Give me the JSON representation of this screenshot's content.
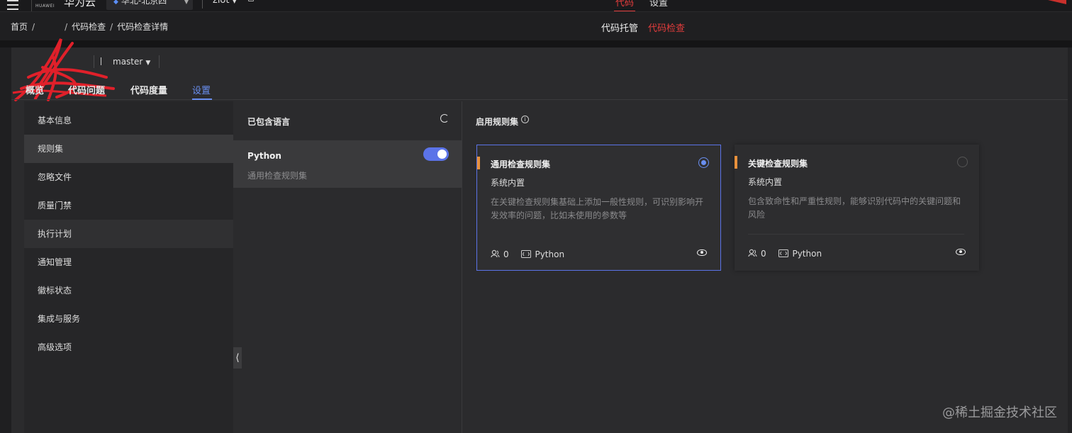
{
  "topbar": {
    "logo_text": "HUAWEI",
    "brand": "华为云",
    "region": "华北-北京四",
    "project": "ziot",
    "tabs": [
      "代码",
      "设置"
    ]
  },
  "breadcrumb": [
    "首页",
    "代码检查",
    "代码检查详情"
  ],
  "center_tabs": [
    "代码托管",
    "代码检查"
  ],
  "repo": {
    "branch": "master"
  },
  "tabs": [
    "概览",
    "代码问题",
    "代码度量",
    "设置"
  ],
  "sidebar": {
    "items": [
      "基本信息",
      "规则集",
      "忽略文件",
      "质量门禁",
      "执行计划",
      "通知管理",
      "徽标状态",
      "集成与服务",
      "高级选项"
    ]
  },
  "languages": {
    "title": "已包含语言",
    "items": [
      {
        "name": "Python",
        "ruleset": "通用检查规则集",
        "enabled": true
      }
    ]
  },
  "rulesets": {
    "title": "启用规则集",
    "cards": [
      {
        "name": "通用检查规则集",
        "type": "系统内置",
        "desc": "在关键检查规则集基础上添加一般性规则，可识别影响开发效率的问题，比如未使用的参数等",
        "users": "0",
        "language": "Python",
        "selected": true
      },
      {
        "name": "关键检查规则集",
        "type": "系统内置",
        "desc": "包含致命性和严重性规则，能够识别代码中的关键问题和风险",
        "users": "0",
        "language": "Python",
        "selected": false
      }
    ]
  },
  "watermark": "@稀土掘金技术社区",
  "colors": {
    "accent": "#5b73e8",
    "brand_red": "#e23c3c",
    "rule_bar": "#e8913c"
  }
}
